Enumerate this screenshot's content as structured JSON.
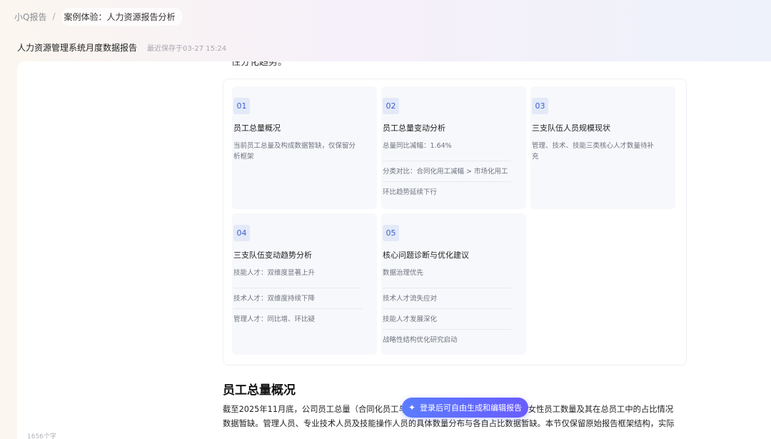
{
  "breadcrumb": {
    "root": "小Q报告",
    "separator": "/",
    "current": "案例体验：人力资源报告分析"
  },
  "doc": {
    "title": "人力资源管理系统月度数据报告",
    "saved": "最近保存于03-27 15:24"
  },
  "cut_text": "性分化趋势。",
  "cards": [
    {
      "num": "01",
      "title": "员工总量概况",
      "items": [
        "当前员工总量及构成数据暂缺，仅保留分析框架"
      ]
    },
    {
      "num": "02",
      "title": "员工总量变动分析",
      "items": [
        "总量同比减幅：1.64%",
        "分类对比：合同化用工减幅 > 市场化用工",
        "环比趋势延续下行"
      ]
    },
    {
      "num": "03",
      "title": "三支队伍人员规模现状",
      "items": [
        "管理、技术、技能三类核心人才数量待补充"
      ]
    },
    {
      "num": "04",
      "title": "三支队伍变动趋势分析",
      "items": [
        "技能人才：双维度显著上升",
        "技术人才：双维度持续下降",
        "管理人才：同比增、环比疑"
      ]
    },
    {
      "num": "05",
      "title": "核心问题诊断与优化建议",
      "items": [
        "数据治理优先",
        "技术人才流失应对",
        "技能人才发展深化",
        "战略性结构优化研究启动"
      ]
    }
  ],
  "section": {
    "heading": "员工总量概况",
    "body_line1_a": "截至2025年11月底，公司员工总量（合同化员工与",
    "body_line1_b": "女性员工数量及其在总员工中的占比情况",
    "body_line2": "数据暂缺。管理人员、专业技术人员及技能操作人员的具体数量分布与各自占比数据暂缺。本节仅保留原始报告框架结构，实际"
  },
  "cta": {
    "label": "登录后可自由生成和编辑报告",
    "icon": "sparkle-icon"
  },
  "footer": {
    "word_count": "1656个字"
  }
}
